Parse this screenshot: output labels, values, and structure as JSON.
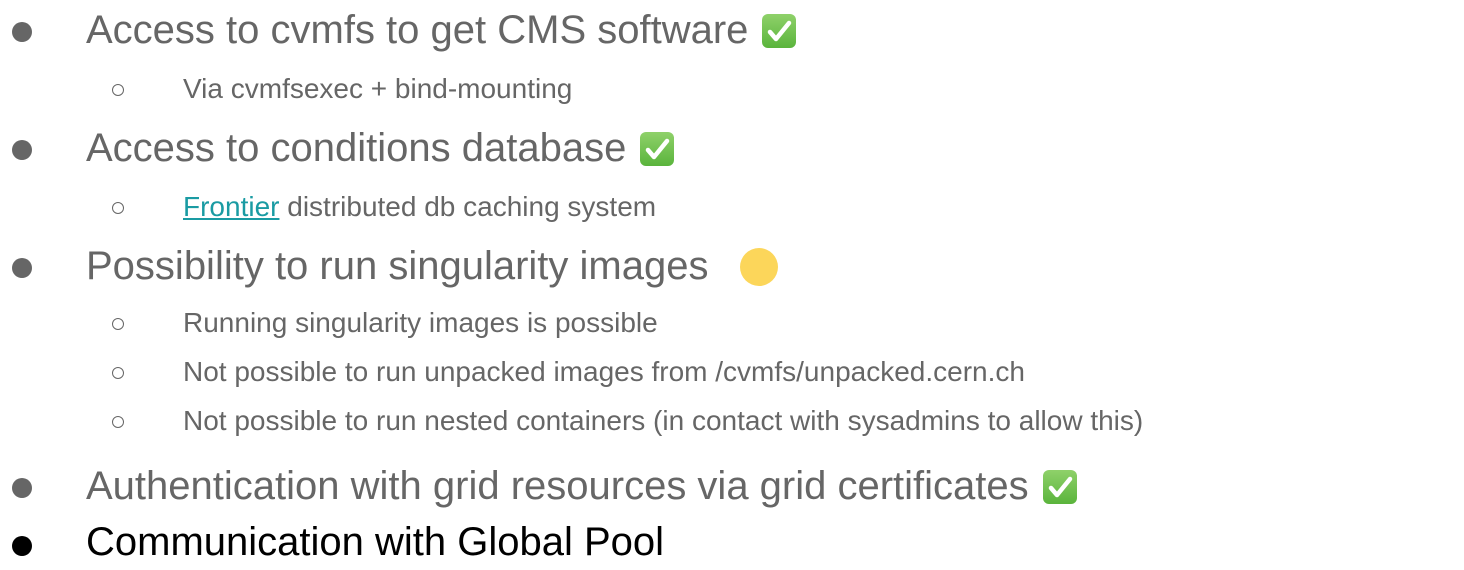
{
  "items": [
    {
      "text": "Access to cvmfs to get CMS software",
      "status_icon": "green-check-icon",
      "sub": [
        {
          "text": "Via cvmfsexec + bind-mounting"
        }
      ]
    },
    {
      "text": "Access to conditions database",
      "status_icon": "green-check-icon",
      "sub": [
        {
          "link": "Frontier",
          "text": " distributed db caching system"
        }
      ]
    },
    {
      "text": "Possibility to run singularity images",
      "status_icon": "yellow-circle-icon",
      "sub": [
        {
          "text": "Running singularity images is possible"
        },
        {
          "text": "Not possible to run unpacked images from /cvmfs/unpacked.cern.ch"
        },
        {
          "text": "Not possible to run nested containers (in contact with sysadmins to allow this)"
        }
      ]
    },
    {
      "text": "Authentication with grid resources via grid certificates",
      "status_icon": "green-check-icon",
      "sub": []
    },
    {
      "text": "Communication with Global Pool",
      "status_icon": "",
      "sub": []
    }
  ],
  "colors": {
    "text_gray": "#666666",
    "text_dark": "#000000",
    "link": "#1a9ba3",
    "check_green": "#5ab43c",
    "pending_yellow": "#fcd65a"
  }
}
